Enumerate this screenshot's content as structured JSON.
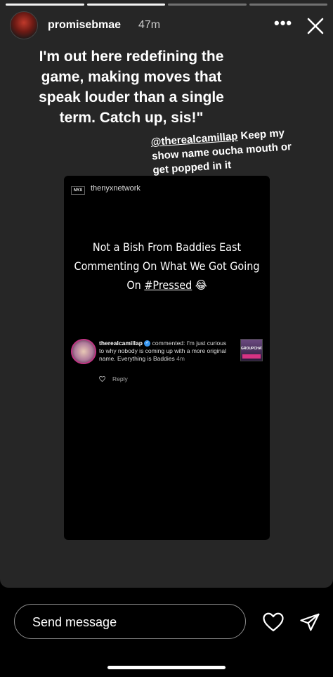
{
  "story": {
    "username": "promisebmae",
    "time_ago": "47m",
    "more_icon": "more-horizontal-icon",
    "close_icon": "close-icon",
    "progress_total": 4,
    "progress_done": 2,
    "caption": "I'm out here redefining the game, making moves that speak louder than a single term. Catch up, sis!\"",
    "mention": {
      "handle": "@therealcamillap",
      "text": " Keep my show name oucha mouth or get popped in it"
    }
  },
  "post": {
    "logo_text": "NYX",
    "account": "thenyxnetwork",
    "headline": "Not a Bish From Baddies East Commenting On What We Got Going On",
    "hashtag": "#Pressed",
    "emoji": "😂",
    "comment": {
      "user": "therealcamillap",
      "verb": " commented: ",
      "text": "I'm just curious to why nobody is coming up with a more original name. Everything is Baddies",
      "time": "4m",
      "reply": "Reply",
      "thumb_text": "GROUPCHAT"
    }
  },
  "footer": {
    "reply_placeholder": "Send message",
    "like_icon": "heart-icon",
    "send_icon": "send-icon"
  }
}
